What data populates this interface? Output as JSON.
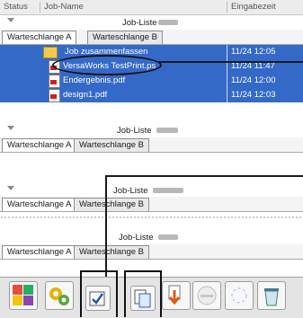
{
  "header": {
    "status_label": "Status",
    "jobname_label": "Job-Name",
    "received_label": "Eingabezeit"
  },
  "queues": [
    {
      "title": "Job-Liste",
      "tabs": [
        "Warteschlange A",
        "Warteschlange B"
      ],
      "jobs": [
        {
          "name": "Job zusammenfassen",
          "date": "11/24 12:05",
          "icon": "folder-icon"
        },
        {
          "name": "VersaWorks TestPrint.ps",
          "date": "11/24 11:47",
          "icon": "pdf-icon"
        },
        {
          "name": "Endergebnis.pdf",
          "date": "11/24 12:00",
          "icon": "pdf-icon"
        },
        {
          "name": "design1.pdf",
          "date": "11/24 12:03",
          "icon": "pdf-icon"
        }
      ]
    },
    {
      "title": "Job-Liste",
      "tabs": [
        "Warteschlange A",
        "Warteschlange B"
      ]
    },
    {
      "title": "Job-Liste",
      "tabs": [
        "Warteschlange A",
        "Warteschlange B"
      ]
    },
    {
      "title": "Job-Liste",
      "tabs": [
        "Warteschlange A",
        "Warteschlange B"
      ]
    }
  ],
  "toolbar": {
    "buttons": [
      "printer-palette-icon",
      "settings-gears-icon",
      "job-setup-icon",
      "copy-job-icon",
      "import-job-icon",
      "cancel-icon",
      "sparkle-icon",
      "trash-icon"
    ]
  },
  "colors": {
    "selection": "#3469c8",
    "header_bg": "#ececec",
    "toolbar_bg": "#e4e4e4",
    "callout": "#111111"
  }
}
